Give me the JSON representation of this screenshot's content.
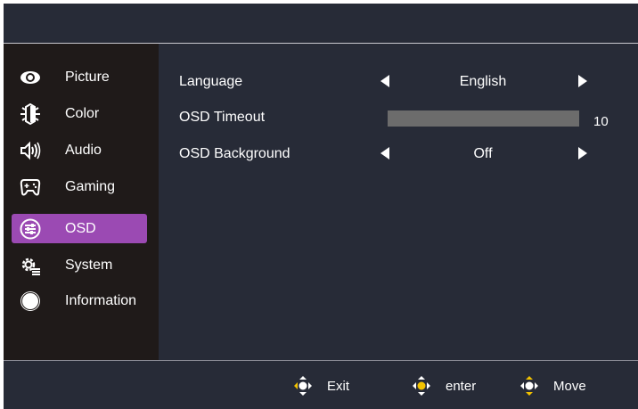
{
  "sidebar": {
    "items": [
      {
        "label": "Picture",
        "icon": "eye-icon",
        "active": false
      },
      {
        "label": "Color",
        "icon": "color-icon",
        "active": false
      },
      {
        "label": "Audio",
        "icon": "speaker-icon",
        "active": false
      },
      {
        "label": "Gaming",
        "icon": "gamepad-icon",
        "active": false
      },
      {
        "label": "OSD",
        "icon": "osd-sliders-icon",
        "active": true
      },
      {
        "label": "System",
        "icon": "system-gear-icon",
        "active": false
      },
      {
        "label": "Information",
        "icon": "info-circle-icon",
        "active": false
      }
    ]
  },
  "settings": {
    "language": {
      "label": "Language",
      "value": "English"
    },
    "osd_timeout": {
      "label": "OSD Timeout",
      "value": "10",
      "level_percent": 100
    },
    "osd_background": {
      "label": "OSD Background",
      "value": "Off"
    }
  },
  "footer": {
    "exit_label": "Exit",
    "enter_label": "enter",
    "move_label": "Move"
  },
  "colors": {
    "panel": "#272b37",
    "sidebar": "#1f1a19",
    "accent": "#9b4ab3",
    "slider": "#6c6c6c",
    "joystick_highlight": "#f2c200"
  }
}
